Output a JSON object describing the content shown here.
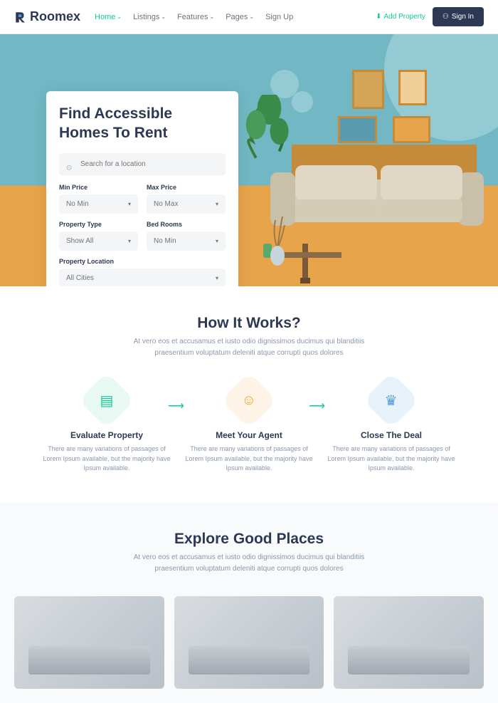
{
  "brand": "Roomex",
  "nav": {
    "items": [
      {
        "label": "Home",
        "active": true,
        "hasDropdown": true
      },
      {
        "label": "Listings",
        "hasDropdown": true
      },
      {
        "label": "Features",
        "hasDropdown": true
      },
      {
        "label": "Pages",
        "hasDropdown": true
      },
      {
        "label": "Sign Up",
        "hasDropdown": false
      }
    ]
  },
  "header": {
    "addProperty": "Add Property",
    "signIn": "Sign In"
  },
  "search": {
    "title": "Find Accessible Homes To Rent",
    "placeholder": "Search for a location",
    "fields": {
      "minPrice": {
        "label": "Min Price",
        "value": "No Min"
      },
      "maxPrice": {
        "label": "Max Price",
        "value": "No Max"
      },
      "propertyType": {
        "label": "Property Type",
        "value": "Show All"
      },
      "bedRooms": {
        "label": "Bed Rooms",
        "value": "No Min"
      },
      "location": {
        "label": "Property Location",
        "value": "All Cities"
      }
    }
  },
  "howItWorks": {
    "title": "How It Works?",
    "subtitle": "At vero eos et accusamus et iusto odio dignissimos ducimus qui blanditiis praesentium voluptatum deleniti atque corrupti quos dolores",
    "steps": [
      {
        "title": "Evaluate Property",
        "desc": "There are many variations of passages of Lorem Ipsum available, but the majority have Ipsum available."
      },
      {
        "title": "Meet Your Agent",
        "desc": "There are many variations of passages of Lorem Ipsum available, but the majority have Ipsum available."
      },
      {
        "title": "Close The Deal",
        "desc": "There are many variations of passages of Lorem Ipsum available, but the majority have Ipsum available."
      }
    ]
  },
  "explore": {
    "title": "Explore Good Places",
    "subtitle": "At vero eos et accusamus et iusto odio dignissimos ducimus qui blanditiis praesentium voluptatum deleniti atque corrupti quos dolores"
  }
}
